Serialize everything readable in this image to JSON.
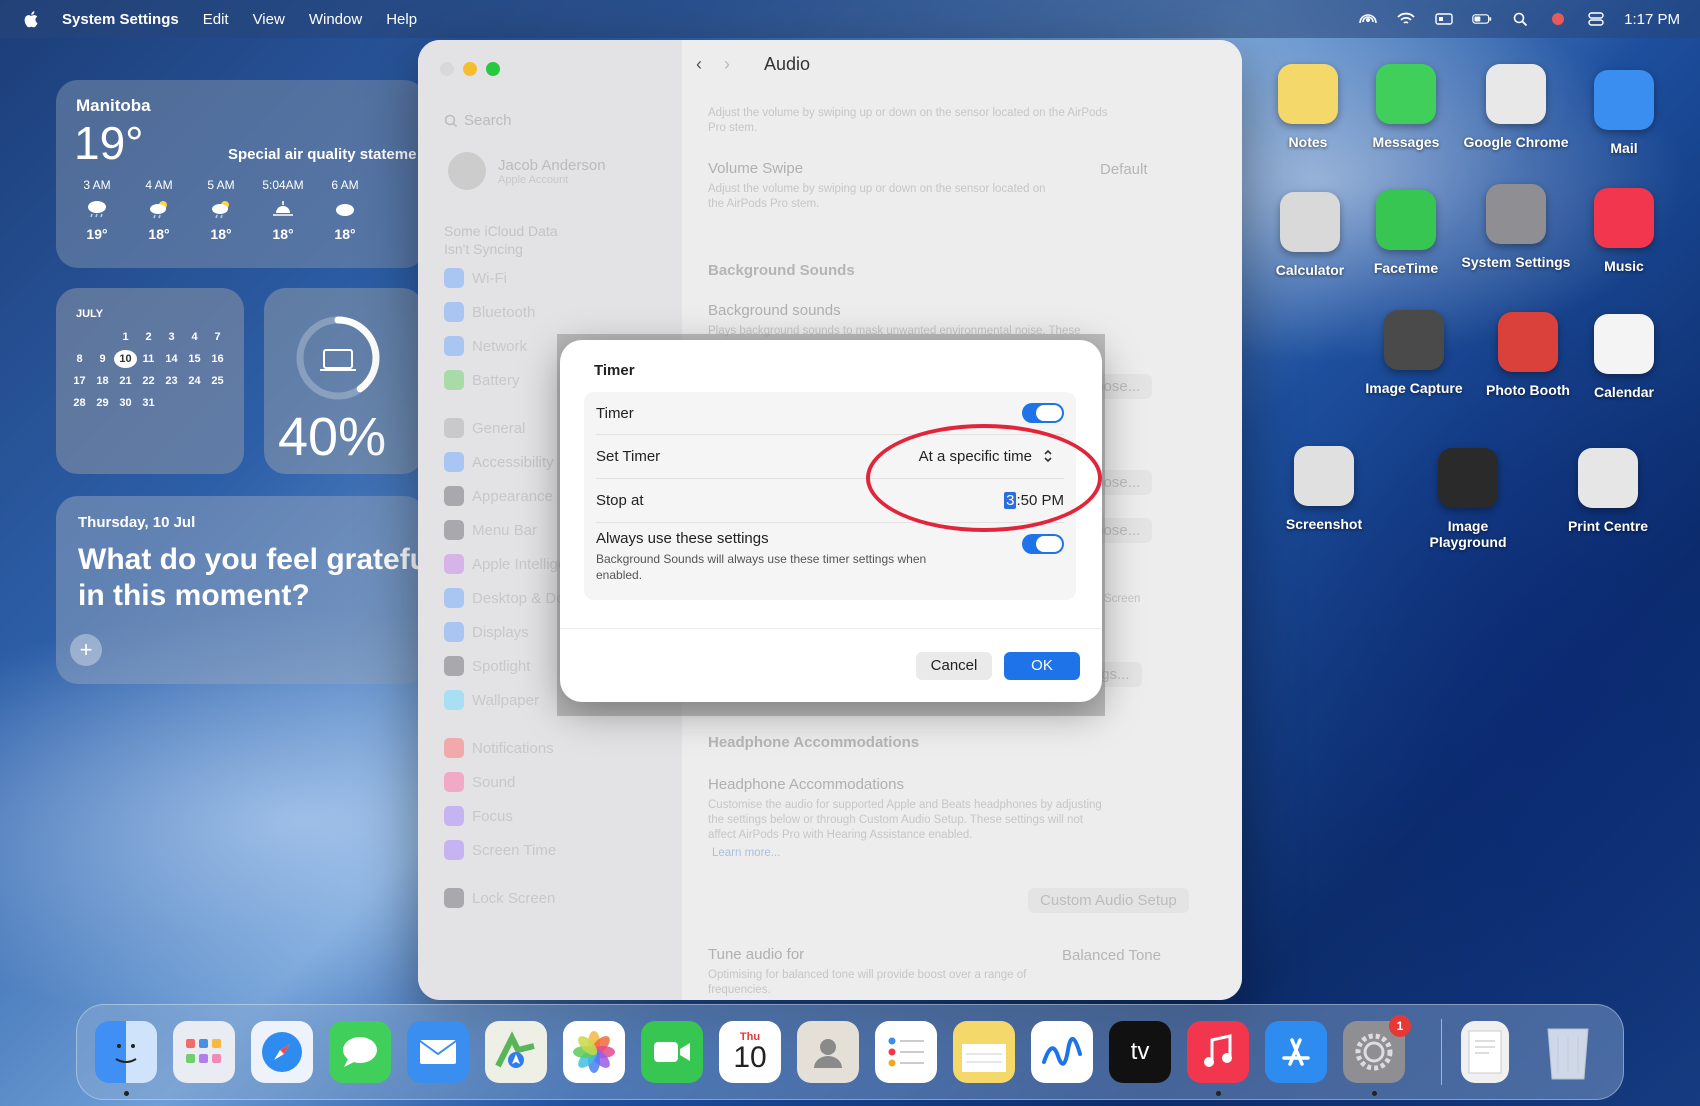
{
  "menubar": {
    "app_name": "System Settings",
    "menus": [
      "Edit",
      "View",
      "Window",
      "Help"
    ],
    "clock": "1:17 PM"
  },
  "widgets": {
    "weather": {
      "location": "Manitoba",
      "temp": "19°",
      "notice": "Special air quality stateme",
      "hours": [
        {
          "time": "3 AM",
          "temp": "19°",
          "icon": "cloud-rain-icon"
        },
        {
          "time": "4 AM",
          "temp": "18°",
          "icon": "cloud-sun-rain-icon"
        },
        {
          "time": "5 AM",
          "temp": "18°",
          "icon": "cloud-sun-rain-icon"
        },
        {
          "time": "5:04AM",
          "temp": "18°",
          "icon": "sunrise-icon"
        },
        {
          "time": "6 AM",
          "temp": "18°",
          "icon": "cloud-icon"
        }
      ]
    },
    "calendar": {
      "month": "JULY",
      "weekdays": [
        "S",
        "M",
        "T",
        "W",
        "T",
        "F",
        "S"
      ],
      "days": [
        "",
        "",
        "1",
        "2",
        "3",
        "4",
        "5",
        "6",
        "7",
        "8",
        "9",
        "10",
        "11",
        "12",
        "13",
        "14",
        "15",
        "16",
        "17",
        "18",
        "19",
        "20",
        "21",
        "22",
        "23",
        "24",
        "25",
        "26",
        "27",
        "28",
        "29",
        "30",
        "31"
      ],
      "today": "10"
    },
    "battery": {
      "percent": "40%",
      "level": 0.4
    },
    "journal": {
      "date": "Thursday, 10 Jul",
      "prompt": "What do you feel grateful for in this moment?"
    }
  },
  "settings": {
    "search_placeholder": "Search",
    "account_name": "Jacob Anderson",
    "account_sub": "Apple Account",
    "icloud_notice": [
      "Some iCloud Data",
      "Isn't Syncing"
    ],
    "sidebar_items": [
      "Wi-Fi",
      "Bluetooth",
      "Network",
      "Battery",
      "General",
      "Accessibility",
      "Appearance",
      "Menu Bar",
      "Apple Intelligence",
      "Desktop & Dock",
      "Displays",
      "Spotlight",
      "Wallpaper",
      "Notifications",
      "Sound",
      "Focus",
      "Screen Time",
      "Lock Screen"
    ],
    "page_title": "Audio",
    "content": {
      "top_desc": "Adjust the volume by swiping up or down on the sensor located on the AirPods Pro stem.",
      "volume_swipe_title": "Volume Swipe",
      "volume_swipe_desc": "Adjust the volume by swiping up or down on the sensor located on the AirPods Pro stem.",
      "volume_swipe_value": "Default",
      "bg_sounds_header": "Background Sounds",
      "bg_sounds_title": "Background sounds",
      "bg_sounds_desc": "Plays background sounds to mask unwanted environmental noise. These",
      "choose_label": "Choose...",
      "screen_fragment": "Screen",
      "settings_fragment": "nd Settings...",
      "headphone_header": "Headphone Accommodations",
      "headphone_title": "Headphone Accommodations",
      "headphone_desc": "Customise the audio for supported Apple and Beats headphones by adjusting the settings below or through Custom Audio Setup. These settings will not affect AirPods Pro with Hearing Assistance enabled.",
      "learn_more": "Learn more...",
      "custom_audio_setup": "Custom Audio Setup",
      "tune_title": "Tune audio for",
      "tune_desc": "Optimising for balanced tone will provide boost over a range of frequencies.",
      "tune_value": "Balanced Tone"
    }
  },
  "dialog": {
    "title": "Timer",
    "timer_label": "Timer",
    "timer_on": true,
    "set_timer_label": "Set Timer",
    "set_timer_value": "At a specific time",
    "stop_at_label": "Stop at",
    "stop_at_selected": "3",
    "stop_at_rest": ":50 PM",
    "always_label": "Always use these settings",
    "always_desc": "Background Sounds will always use these timer settings when enabled.",
    "always_on": true,
    "cancel_label": "Cancel",
    "ok_label": "OK"
  },
  "desktop_icons": [
    {
      "label": "Notes",
      "color": "#f5d86a"
    },
    {
      "label": "Messages",
      "color": "#3fcf5a"
    },
    {
      "label": "Google Chrome",
      "color": "#e8e8e8"
    },
    {
      "label": "Mail",
      "color": "#3a8ef0"
    },
    {
      "label": "Calculator",
      "color": "#d9d9d9"
    },
    {
      "label": "FaceTime",
      "color": "#38c653"
    },
    {
      "label": "System Settings",
      "color": "#8e8e93"
    },
    {
      "label": "Music",
      "color": "#f2364e"
    },
    {
      "label": "Image Capture",
      "color": "#4a4a4a"
    },
    {
      "label": "Photo Booth",
      "color": "#d9413a"
    },
    {
      "label": "Calendar",
      "color": "#f4f4f4"
    },
    {
      "label": "Screenshot",
      "color": "#e0e0e0"
    },
    {
      "label": "Image Playground",
      "color": "#2a2a2a"
    },
    {
      "label": "Print Centre",
      "color": "#e6e6e6"
    }
  ],
  "dock": {
    "calendar_day": "Thu",
    "calendar_date": "10",
    "tv_label": "tv",
    "settings_badge": "1"
  },
  "colors": {
    "accent": "#1e73e8",
    "annotation": "#e2253a"
  }
}
